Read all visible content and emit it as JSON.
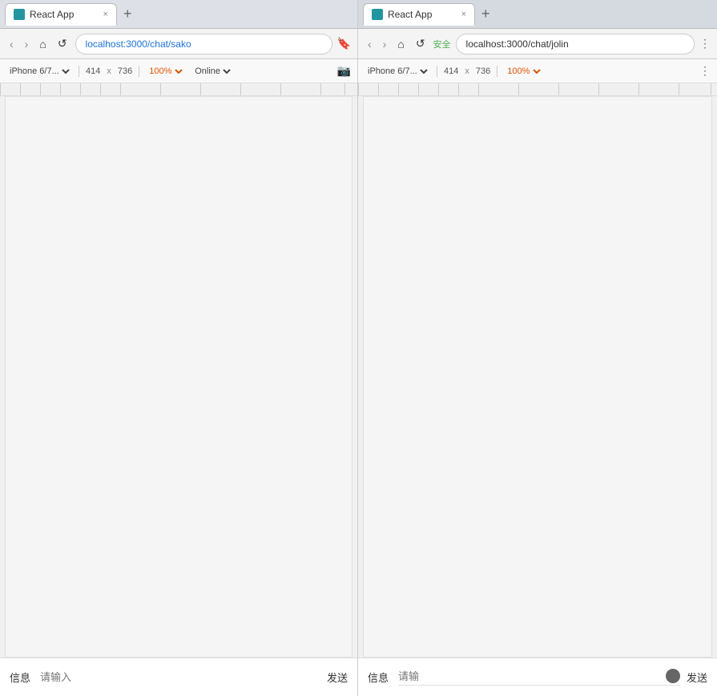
{
  "left": {
    "tab": {
      "title": "React App",
      "favicon_color": "#2196a0",
      "close": "×"
    },
    "add_tab": "+",
    "nav": {
      "back": "‹",
      "forward": "›",
      "home": "⌂",
      "reload": "↺",
      "url": "localhost:3000/chat/sako"
    },
    "device": {
      "device_name": "iPhone 6/7...",
      "width": "414",
      "x": "x",
      "height": "736",
      "zoom": "100%",
      "status": "Online"
    },
    "chat": {
      "label": "信息",
      "placeholder": "请输入",
      "send": "发送"
    }
  },
  "right": {
    "tab": {
      "title": "React App",
      "favicon_color": "#2196a0",
      "close": "×"
    },
    "add_tab": "+",
    "nav": {
      "back": "‹",
      "forward": "›",
      "home": "⌂",
      "reload": "↺",
      "security_label": "安全",
      "url": "localhost:3000/chat/jolin"
    },
    "device": {
      "device_name": "iPhone 6/7...",
      "width": "414",
      "x": "x",
      "height": "736",
      "zoom": "100%"
    },
    "chat": {
      "label": "信息",
      "placeholder": "请输",
      "send": "发送"
    }
  }
}
